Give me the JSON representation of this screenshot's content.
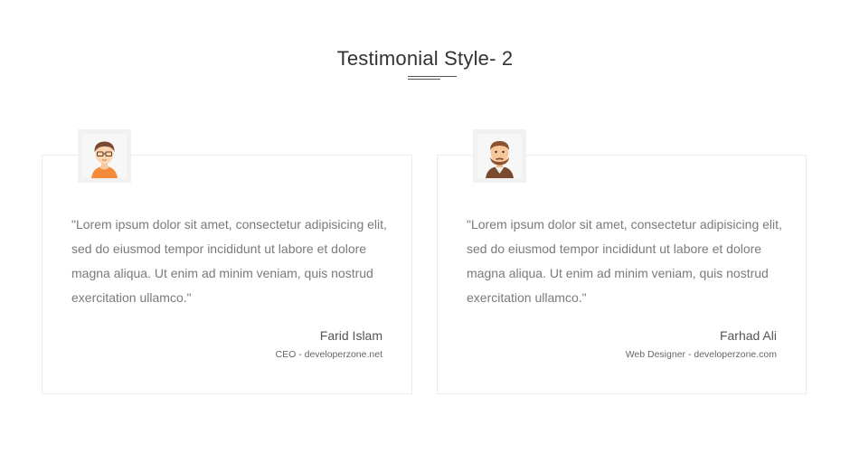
{
  "section": {
    "title": "Testimonial Style- 2"
  },
  "testimonials": [
    {
      "avatar": "avatar-glasses-icon",
      "quote": "\"Lorem ipsum dolor sit amet, consectetur adipisicing elit, sed do eiusmod tempor incididunt ut labore et dolore magna aliqua. Ut enim ad minim veniam, quis nostrud exercitation ullamco.\"",
      "name": "Farid Islam",
      "role": "CEO - developerzone.net"
    },
    {
      "avatar": "avatar-beard-icon",
      "quote": "\"Lorem ipsum dolor sit amet, consectetur adipisicing elit, sed do eiusmod tempor incididunt ut labore et dolore magna aliqua. Ut enim ad minim veniam, quis nostrud exercitation ullamco.\"",
      "name": "Farhad Ali",
      "role": "Web Designer - developerzone.com"
    }
  ],
  "colors": {
    "background": "#ffffff",
    "title": "#333333",
    "quote_text": "#7a7a7a",
    "card_border": "#ececec",
    "avatar_frame": "#f1f1f1"
  }
}
